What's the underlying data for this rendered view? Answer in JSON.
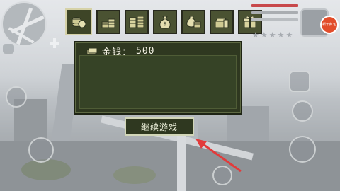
{
  "hud": {
    "money_label": "金钱：",
    "money_value": "500",
    "continue_label": "继续游戏",
    "wanted_stars": [
      "★",
      "★",
      "★",
      "★",
      "★"
    ],
    "badge_text": "新年红包"
  },
  "shop_tabs": [
    {
      "name": "coins-tab",
      "icon": "coin-stack-icon",
      "active": true
    },
    {
      "name": "coin-pile-tab",
      "icon": "coin-pile-icon",
      "active": false
    },
    {
      "name": "coin-tower-tab",
      "icon": "coin-tower-icon",
      "active": false
    },
    {
      "name": "money-bag-tab",
      "icon": "money-bag-icon",
      "active": false
    },
    {
      "name": "cash-bag-tab",
      "icon": "cash-bag-icon",
      "active": false
    },
    {
      "name": "chest-tab",
      "icon": "chest-coins-icon",
      "active": false
    },
    {
      "name": "gift-tab",
      "icon": "gift-icon",
      "active": false
    }
  ],
  "colors": {
    "panel_bg": "#2f3820",
    "tab_bg": "#4a5232",
    "health_bar": "#c8494b",
    "armor_bar": "#a9adb1",
    "arrow": "#e23b3b",
    "badge": "#e24d2b"
  }
}
